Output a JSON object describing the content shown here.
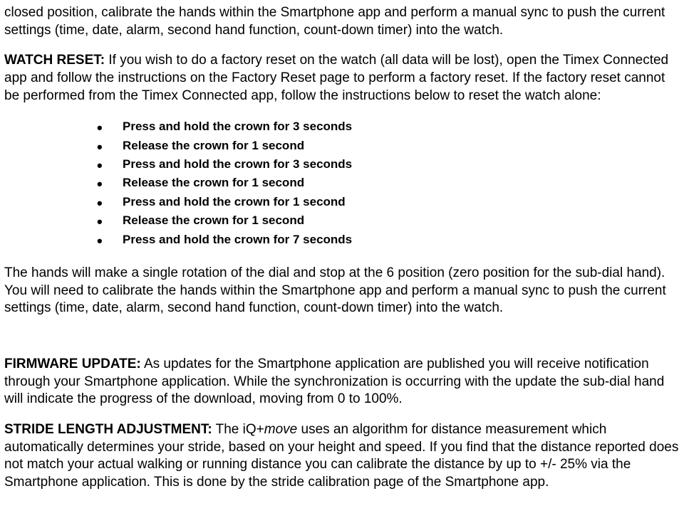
{
  "intro_fragment": "closed position, calibrate the hands within the Smartphone app and perform a manual sync to push the current settings (time, date, alarm, second hand function, count-down timer) into the watch.",
  "watch_reset": {
    "heading": "WATCH RESET:",
    "body": "  If you wish to do a factory reset on the watch (all data will be lost), open the Timex Connected app and follow the instructions on the Factory Reset page to perform a factory reset.  If the factory reset cannot be performed from the Timex Connected app, follow the instructions below to reset the watch alone:"
  },
  "reset_steps": [
    "Press and hold the crown for 3 seconds",
    "Release the crown for 1 second",
    "Press and hold the crown for 3 seconds",
    "Release the crown for 1 second",
    "Press and hold the crown for 1 second",
    "Release the crown for 1 second",
    "Press and hold the crown for 7 seconds"
  ],
  "post_reset": " The hands will make a single rotation of the dial and stop at the 6 position (zero position for the sub-dial hand).   You will need to calibrate the hands within the Smartphone app and perform a manual sync to push the current settings (time, date, alarm, second hand function, count-down timer) into the watch.",
  "firmware": {
    "heading": "FIRMWARE UPDATE:",
    "body": "  As updates for the Smartphone application are published you will receive notification through your Smartphone application.  While the synchronization is occurring with the update the sub-dial hand will indicate the progress of the download, moving from 0 to 100%."
  },
  "stride": {
    "heading": "STRIDE LENGTH ADJUSTMENT:",
    "prefix": "  The iQ+",
    "italic": "move",
    "suffix": " uses an algorithm for distance measurement which automatically determines your stride, based on your height and speed. If you find that the distance reported does not match your actual walking or running distance you can calibrate the distance by up to +/- 25% via the Smartphone application. This is done by the stride calibration page of the Smartphone app."
  }
}
